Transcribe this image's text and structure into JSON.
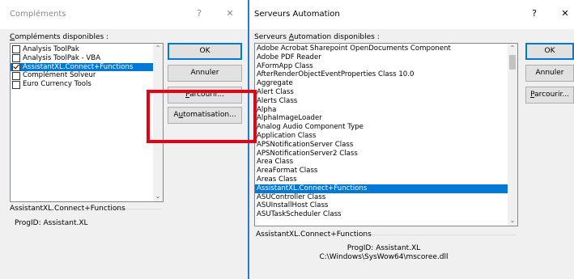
{
  "addins_dialog": {
    "title": "Compléments",
    "help": "?",
    "close": "✕",
    "available_label_underlined": "C",
    "available_label_rest": "ompléments disponibles :",
    "items": [
      {
        "label": "Analysis ToolPak",
        "checked": false,
        "selected": false
      },
      {
        "label": "Analysis ToolPak - VBA",
        "checked": false,
        "selected": false
      },
      {
        "label": "AssistantXL.Connect+Functions",
        "checked": true,
        "selected": true
      },
      {
        "label": "Complément Solveur",
        "checked": false,
        "selected": false
      },
      {
        "label": "Euro Currency Tools",
        "checked": false,
        "selected": false
      }
    ],
    "buttons": {
      "ok": "OK",
      "cancel": "Annuler",
      "browse_underlined": "P",
      "browse_rest": "arcourir...",
      "automation_pre": "A",
      "automation_underlined": "u",
      "automation_rest": "tomatisation..."
    },
    "details_title": "AssistantXL.Connect+Functions",
    "details_progid": "ProgID: Assistant.XL"
  },
  "automation_dialog": {
    "title": "Serveurs Automation",
    "help": "?",
    "close": "✕",
    "available_label_pre": "Serveurs ",
    "available_label_underlined": "A",
    "available_label_rest": "utomation disponibles :",
    "items": [
      "Adobe Acrobat Sharepoint OpenDocuments Component",
      "Adobe PDF Reader",
      "AFormApp Class",
      "AfterRenderObjectEventProperties Class 10.0",
      "Aggregate",
      "Alert Class",
      "Alerts Class",
      "Alpha",
      "AlphaImageLoader",
      "Analog Audio Component Type",
      "Application Class",
      "APSNotificationServer Class",
      "APSNotificationServer2 Class",
      "Area Class",
      "AreaFormat Class",
      "Areas Class",
      "AssistantXL.Connect+Functions",
      "ASUController Class",
      "ASUInstallHost Class",
      "ASUTaskScheduler Class"
    ],
    "selected_index": 16,
    "buttons": {
      "ok": "OK",
      "cancel": "Annuler",
      "browse_underlined": "P",
      "browse_rest": "arcourir..."
    },
    "details_title": "AssistantXL.Connect+Functions",
    "details_progid": "ProgID: Assistant.XL",
    "details_path": "C:\\Windows\\SysWow64\\mscoree.dll"
  },
  "colors": {
    "selection": "#0078d7",
    "highlight_box": "#e60012",
    "dialog_bg": "#f0f0f0"
  }
}
